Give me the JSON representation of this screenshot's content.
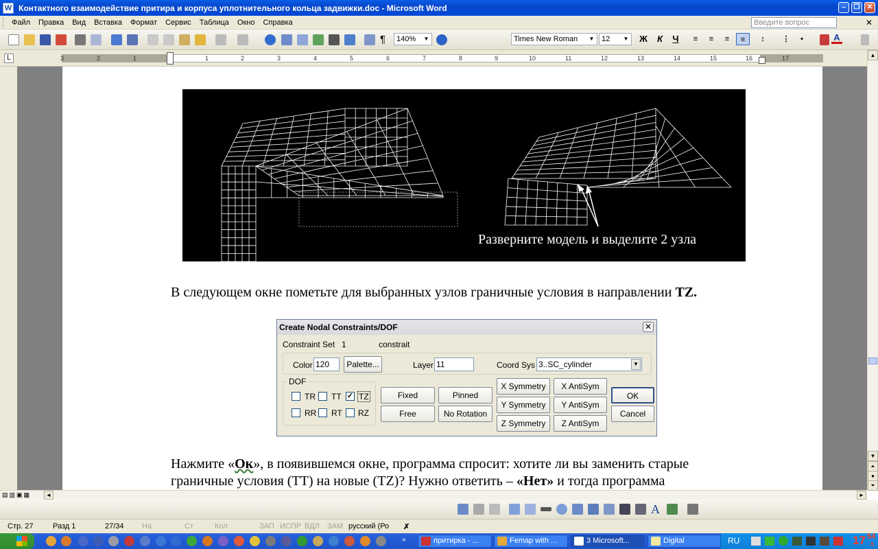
{
  "window": {
    "title": "Контактного взаимодействие притира и корпуса уплотнительного  кольца задвижки.doc - Microsoft Word",
    "app_icon": "W"
  },
  "menu": {
    "items": [
      "Файл",
      "Правка",
      "Вид",
      "Вставка",
      "Формат",
      "Сервис",
      "Таблица",
      "Окно",
      "Справка"
    ],
    "question_placeholder": "Введите вопрос"
  },
  "toolbar": {
    "zoom": "140%",
    "font": "Times New Roman",
    "size": "12",
    "bold": "Ж",
    "italic": "К",
    "underline": "Ч",
    "pilcrow": "¶",
    "font_color_letter": "A"
  },
  "ruler": {
    "numbers": [
      "3",
      "2",
      "1",
      "1",
      "2",
      "3",
      "4",
      "5",
      "6",
      "7",
      "8",
      "9",
      "10",
      "11",
      "12",
      "13",
      "14",
      "15",
      "16",
      "17"
    ]
  },
  "document": {
    "figure_caption": "Разверните модель и выделите 2 узла",
    "para1_main": "В следующем окне пометьте для выбранных узлов граничные условия в направлении ",
    "para1_bold": "TZ.",
    "para2_line1_a": "Нажмите «",
    "para2_line1_ok": "Ок",
    "para2_line1_b": "», в появившемся окне, программа спросит: хотите ли вы заменить старые",
    "para2_line2_a": "граничные  условия  (ТТ)  на  новые  (TZ)?  Нужно  ответить  –  ",
    "para2_line2_net": "«Нет»",
    "para2_line2_b": "  и  тогда   программа"
  },
  "dialog": {
    "title": "Create Nodal Constraints/DOF",
    "constraint_set_label": "Constraint Set",
    "constraint_set_id": "1",
    "constraint_set_name": "constrait",
    "color_label": "Color",
    "color_value": "120",
    "palette_button": "Palette...",
    "layer_label": "Layer",
    "layer_value": "11",
    "coord_label": "Coord Sys",
    "coord_value": "3..SC_cylinder",
    "dof_label": "DOF",
    "dof": [
      {
        "label": "TR",
        "checked": false
      },
      {
        "label": "TT",
        "checked": false
      },
      {
        "label": "TZ",
        "checked": true
      },
      {
        "label": "RR",
        "checked": false
      },
      {
        "label": "RT",
        "checked": false
      },
      {
        "label": "RZ",
        "checked": false
      }
    ],
    "buttons": {
      "fixed": "Fixed",
      "pinned": "Pinned",
      "free": "Free",
      "no_rotation": "No Rotation",
      "x_sym": "X Symmetry",
      "x_anti": "X AntiSym",
      "y_sym": "Y Symmetry",
      "y_anti": "Y AntiSym",
      "z_sym": "Z Symmetry",
      "z_anti": "Z AntiSym",
      "ok": "OK",
      "cancel": "Cancel"
    },
    "check_mark": "✓"
  },
  "status": {
    "page": "Стр. 27",
    "section": "Разд 1",
    "count": "27/34",
    "at": "На",
    "line": "Ст",
    "col": "Кол",
    "rec": "ЗАП",
    "trk": "ИСПР",
    "ext": "ВДЛ",
    "ovr": "ЗАМ",
    "lang": "русский (Ро"
  },
  "taskbar": {
    "tasks": [
      {
        "label": "притирка - ...",
        "active": false
      },
      {
        "label": "Femap with ...",
        "active": false
      },
      {
        "label": "3 Microsoft...",
        "active": true
      },
      {
        "label": "Digital",
        "active": false
      }
    ],
    "lang": "RU",
    "clock_hour": "17",
    "clock_min": "54",
    "clock_extra": "8"
  },
  "colors": {
    "accent": "#0747c9",
    "chrome": "#ece9d8",
    "figure_bg": "#000000",
    "mesh": "#ffffff"
  }
}
